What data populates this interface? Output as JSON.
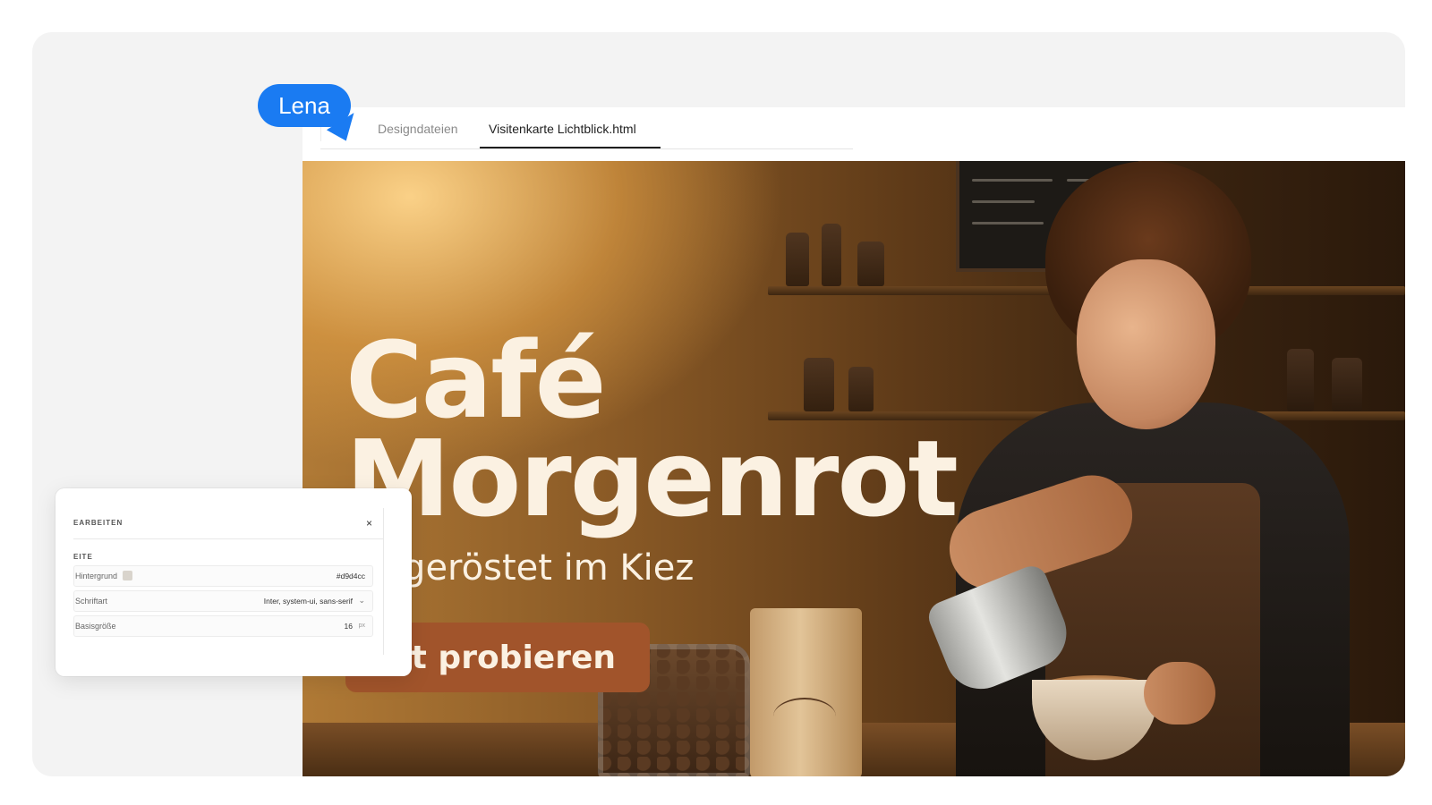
{
  "collaborator": {
    "name": "Lena",
    "color": "#1a7bf2"
  },
  "tabs": [
    {
      "label": "Designdateien",
      "active": false
    },
    {
      "label": "Visitenkarte Lichtblick.html",
      "active": true
    }
  ],
  "hero": {
    "title_line1": "Café",
    "title_line2": "Morgenrot",
    "subtitle": "ch geröstet im Kiez",
    "cta_label": "tzt probieren",
    "cta_color": "#a1542b",
    "text_color": "#fbf1e2"
  },
  "edit_panel": {
    "title": "EARBEITEN",
    "close_icon": "close-icon",
    "section_label": "EITE",
    "fields": [
      {
        "label": "Hintergrund",
        "value": "#d9d4cc",
        "swatch": "#d9d4cc"
      },
      {
        "label": "Schriftart",
        "value": "Inter, system-ui, sans-serif"
      },
      {
        "label": "Basisgröße",
        "value": "16",
        "unit": "px"
      }
    ]
  }
}
